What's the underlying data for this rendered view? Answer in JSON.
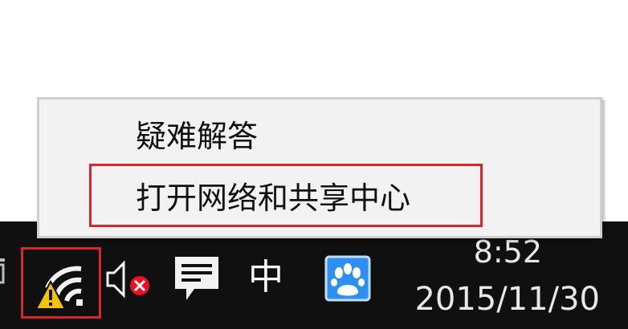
{
  "context_menu": {
    "items": [
      {
        "label": "疑难解答",
        "highlighted": false
      },
      {
        "label": "打开网络和共享中心",
        "highlighted": true
      }
    ],
    "highlight_color": "#d9272e"
  },
  "taskbar": {
    "background": "#101010",
    "tray_icons": [
      {
        "icon": "network-warning-icon",
        "highlighted": true
      },
      {
        "icon": "volume-muted-icon"
      },
      {
        "icon": "action-center-icon"
      },
      {
        "icon": "baidu-paw-icon"
      }
    ],
    "ime_label": "中",
    "clock": {
      "time": "8:52",
      "date": "2015/11/30"
    }
  }
}
